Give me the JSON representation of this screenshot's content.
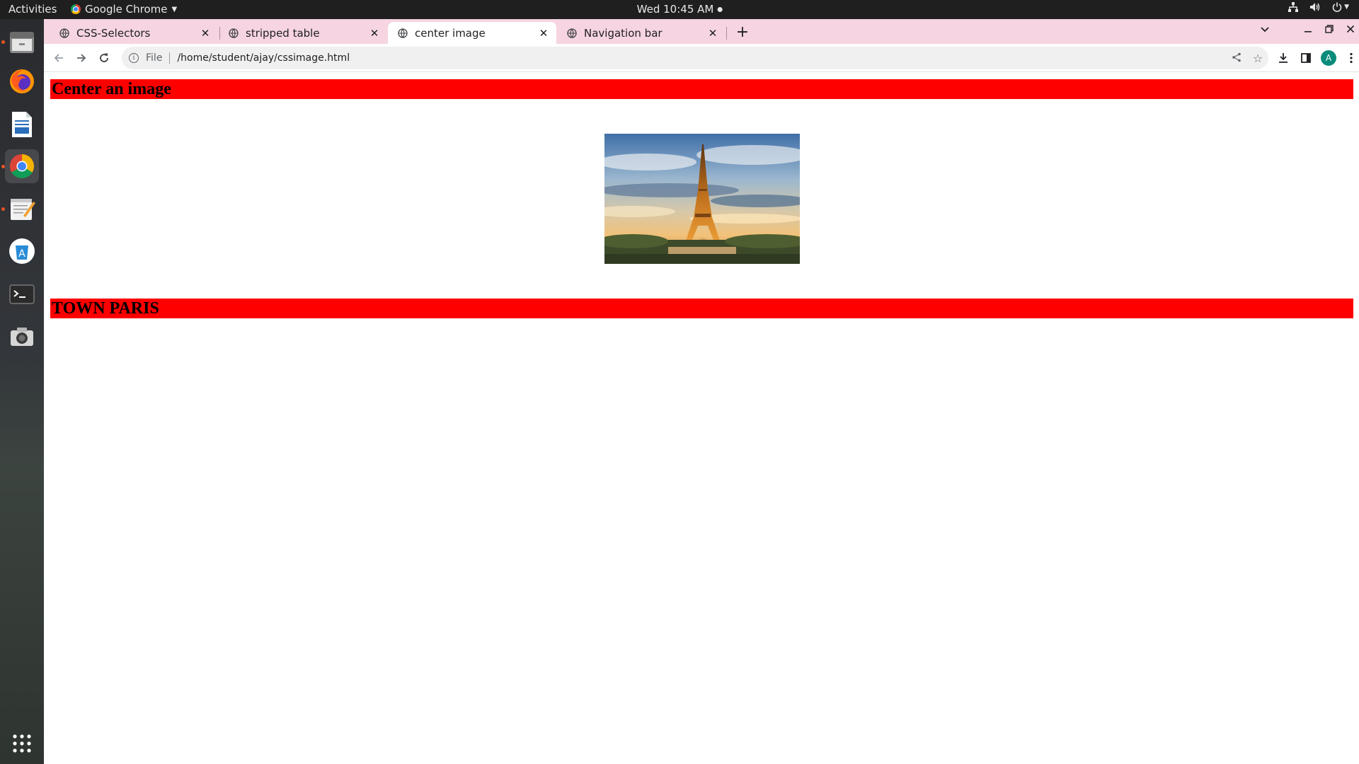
{
  "system_bar": {
    "activities": "Activities",
    "app_name": "Google Chrome",
    "clock": "Wed 10:45 AM",
    "tray_icons": [
      "network-icon",
      "volume-icon",
      "power-icon"
    ]
  },
  "dock": {
    "items": [
      "files-icon",
      "firefox-icon",
      "writer-icon",
      "chrome-icon",
      "text-editor-icon",
      "software-center-icon",
      "terminal-icon",
      "camera-icon"
    ],
    "apps_grid": "show-apps-icon"
  },
  "browser": {
    "tabs": [
      {
        "label": "CSS-Selectors",
        "active": false
      },
      {
        "label": "stripped table",
        "active": false
      },
      {
        "label": "center image",
        "active": true
      },
      {
        "label": "Navigation bar",
        "active": false
      }
    ],
    "address": {
      "scheme_label": "File",
      "url": "/home/student/ajay/cssimage.html"
    },
    "profile_initial": "A",
    "accent": "#f6d4e1"
  },
  "page": {
    "heading_1": "Center an image",
    "heading_2": "TOWN PARIS",
    "heading_bg": "#ff0000",
    "image_subject": "eiffel-tower-photo"
  }
}
